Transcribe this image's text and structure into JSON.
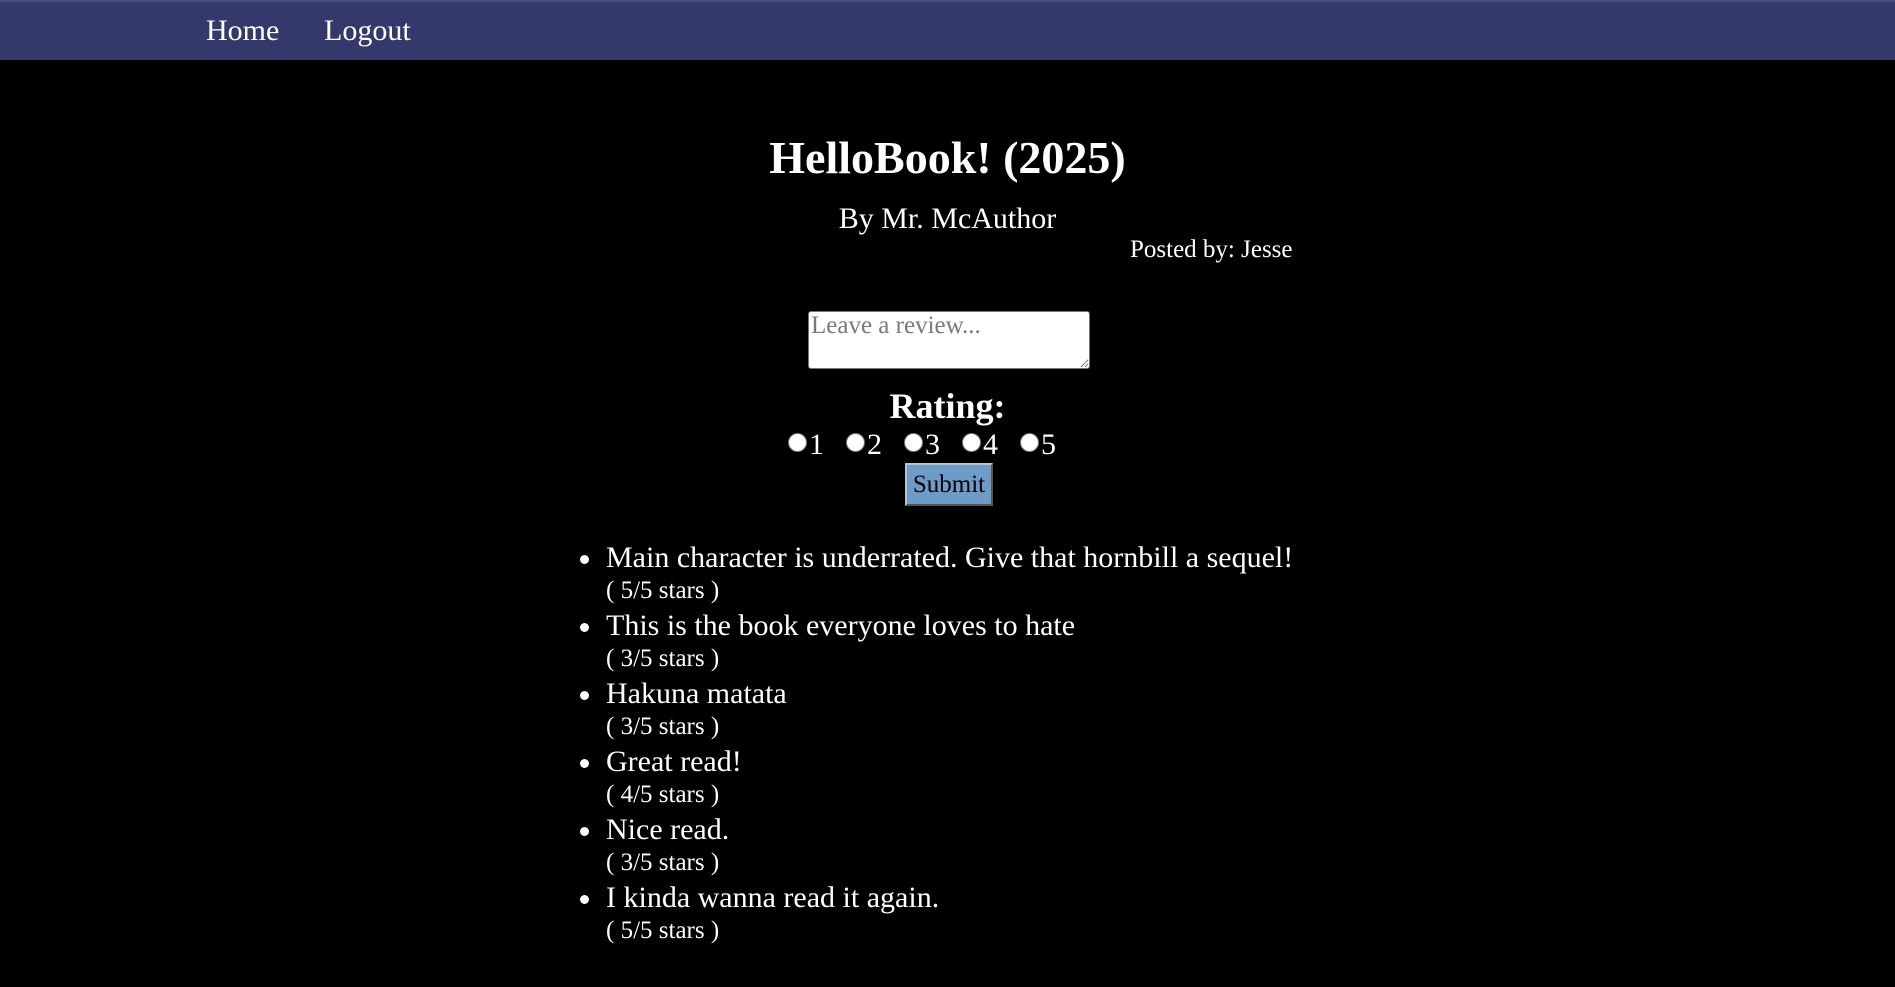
{
  "nav": {
    "home_label": "Home",
    "logout_label": "Logout"
  },
  "book": {
    "title": "HelloBook! (2025)",
    "author_line": "By Mr. McAuthor",
    "posted_by": "Posted by: Jesse"
  },
  "review_form": {
    "placeholder": "Leave a review...",
    "value": "",
    "rating_label": "Rating:",
    "rating_options": [
      "1",
      "2",
      "3",
      "4",
      "5"
    ],
    "selected_rating": null,
    "submit_label": "Submit"
  },
  "reviews": [
    {
      "text": "Main character is underrated. Give that hornbill a sequel!",
      "stars": "( 5/5 stars )",
      "rating": 5
    },
    {
      "text": "This is the book everyone loves to hate",
      "stars": "( 3/5 stars )",
      "rating": 3
    },
    {
      "text": "Hakuna matata",
      "stars": "( 3/5 stars )",
      "rating": 3
    },
    {
      "text": "Great read!",
      "stars": "( 4/5 stars )",
      "rating": 4
    },
    {
      "text": "Nice read.",
      "stars": "( 3/5 stars )",
      "rating": 3
    },
    {
      "text": "I kinda wanna read it again.",
      "stars": "( 5/5 stars )",
      "rating": 5
    }
  ],
  "colors": {
    "navbar": "#35386b",
    "background": "#000000",
    "text": "#ffffff",
    "submit_button": "#6e9cc9"
  }
}
